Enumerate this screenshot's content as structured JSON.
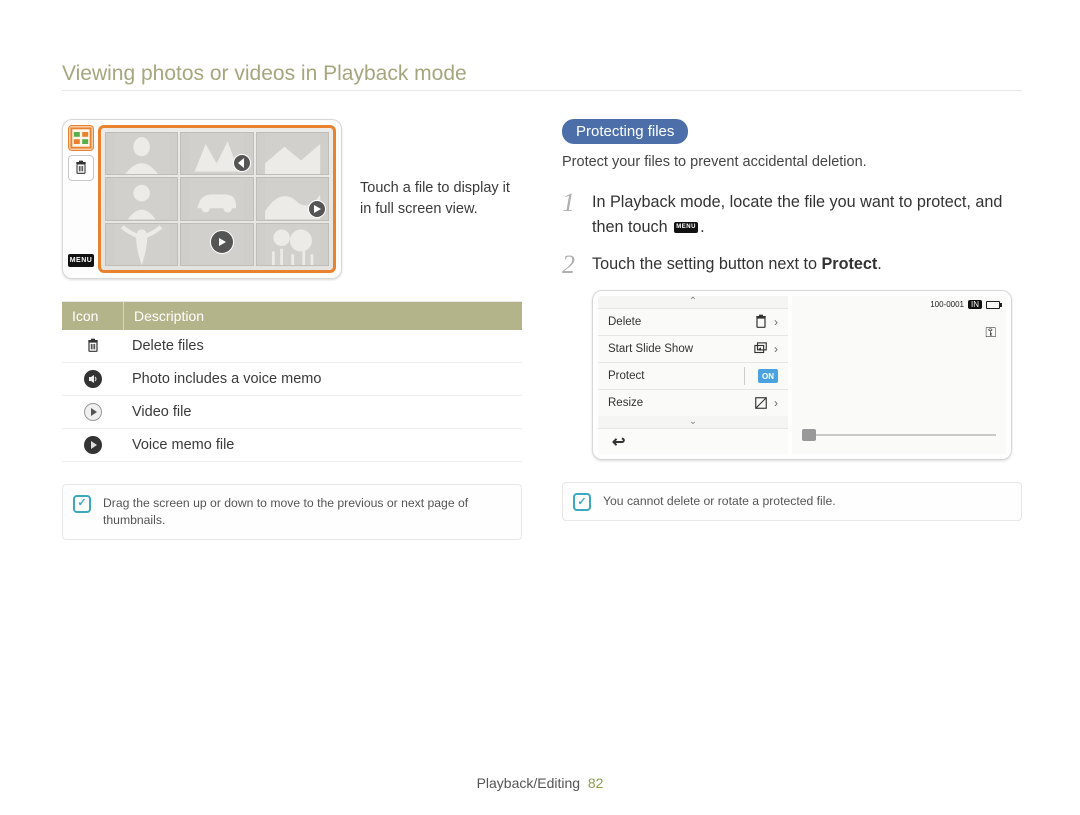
{
  "page_title": "Viewing photos or videos in Playback mode",
  "left": {
    "toolbar": {
      "menu": "MENU"
    },
    "caption": "Touch a file to display it in full screen view.",
    "table": {
      "headers": {
        "icon": "Icon",
        "desc": "Description"
      },
      "rows": [
        {
          "desc": "Delete files"
        },
        {
          "desc": "Photo includes a voice memo"
        },
        {
          "desc": "Video file"
        },
        {
          "desc": "Voice memo file"
        }
      ]
    },
    "note": "Drag the screen up or down to move to the previous or next page of thumbnails."
  },
  "right": {
    "pill": "Protecting files",
    "intro": "Protect your files to prevent accidental deletion.",
    "steps": [
      {
        "num": "1",
        "pre": "In Playback mode, locate the file you want to protect, and then touch ",
        "menu": "MENU",
        "post": "."
      },
      {
        "num": "2",
        "pre": "Touch the setting button next to ",
        "bold": "Protect",
        "post": "."
      }
    ],
    "menu": {
      "items": [
        {
          "label": "Delete",
          "icon": "trash"
        },
        {
          "label": "Start Slide Show",
          "icon": "slideshow"
        },
        {
          "label": "Protect",
          "icon": "on",
          "on": "ON"
        },
        {
          "label": "Resize",
          "icon": "resize"
        }
      ],
      "file_id": "100-0001",
      "storage": "IN"
    },
    "note": "You cannot delete or rotate a protected file."
  },
  "footer": {
    "label": "Playback/Editing",
    "page": "82"
  }
}
